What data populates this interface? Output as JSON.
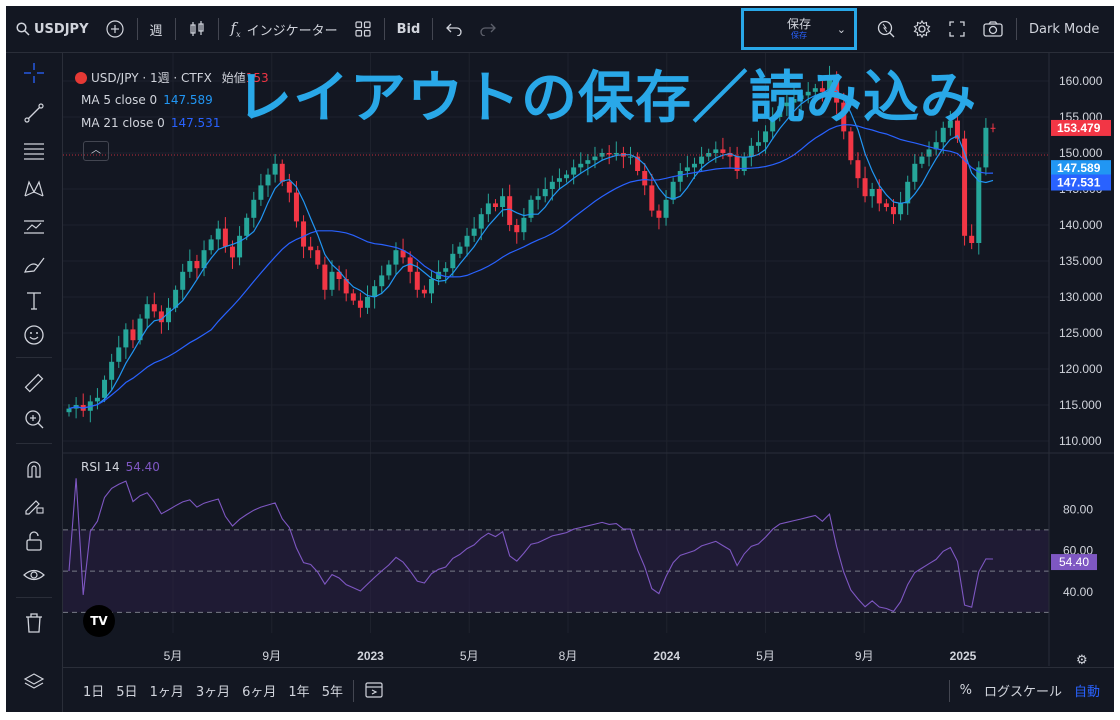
{
  "overlay_title": "レイアウトの保存／読み込み",
  "topbar": {
    "symbol": "USDJPY",
    "interval": "週",
    "indicators": "インジケーター",
    "bid": "Bid",
    "save_label": "保存",
    "save_sublabel": "保存",
    "dark_mode": "Dark Mode"
  },
  "legend": {
    "main": "USD/JPY · 1週 · CTFX",
    "open_label": "始値",
    "open_value": "153",
    "ma5_label": "MA 5 close 0",
    "ma5_value": "147.589",
    "ma21_label": "MA 21 close 0",
    "ma21_value": "147.531",
    "rsi_label": "RSI 14",
    "rsi_value": "54.40"
  },
  "price_axis": {
    "ticks": [
      "160.000",
      "155.000",
      "150.000",
      "145.000",
      "140.000",
      "135.000",
      "130.000",
      "125.000",
      "120.000",
      "115.000",
      "110.000"
    ],
    "labels": [
      {
        "text": "153.479",
        "color": "#f23645"
      },
      {
        "text": "147.589",
        "color": "#2196f3"
      },
      {
        "text": "147.531",
        "color": "#2962ff"
      }
    ]
  },
  "rsi_axis": {
    "ticks": [
      "80.00",
      "60.00",
      "40.00"
    ],
    "current": "54.40"
  },
  "time_axis": [
    "5月",
    "9月",
    "2023",
    "5月",
    "8月",
    "2024",
    "5月",
    "9月",
    "2025"
  ],
  "bottombar": {
    "ranges": [
      "1日",
      "5日",
      "1ヶ月",
      "3ヶ月",
      "6ヶ月",
      "1年",
      "5年"
    ],
    "percent": "%",
    "log": "ログスケール",
    "auto": "自動"
  },
  "colors": {
    "up": "#26a69a",
    "down": "#f23645",
    "ma5": "#2196f3",
    "ma21": "#2962ff",
    "rsi": "#7e57c2",
    "accent": "#29a8e8"
  },
  "chart_data": {
    "type": "candlestick",
    "price_range": [
      110,
      160
    ],
    "rsi_range": [
      20,
      100
    ],
    "rsi_band": [
      30,
      70
    ],
    "closes": [
      114.5,
      115.0,
      114.2,
      115.5,
      116.0,
      118.5,
      121.0,
      123.0,
      125.5,
      124.0,
      127.0,
      129.0,
      128.0,
      126.5,
      128.5,
      131.0,
      133.5,
      135.0,
      134.0,
      136.5,
      138.0,
      139.5,
      137.0,
      135.5,
      138.5,
      141.0,
      143.5,
      145.5,
      147.0,
      148.5,
      146.0,
      144.5,
      140.5,
      137.0,
      136.5,
      134.5,
      131.0,
      133.5,
      132.5,
      130.5,
      129.5,
      128.5,
      130.0,
      131.5,
      133.0,
      134.5,
      136.5,
      135.5,
      133.5,
      131.0,
      130.5,
      132.5,
      133.5,
      134.0,
      136.0,
      137.0,
      138.5,
      139.5,
      141.5,
      143.0,
      142.5,
      144.0,
      140.0,
      139.0,
      141.0,
      143.5,
      144.0,
      145.0,
      146.0,
      146.5,
      147.0,
      148.0,
      148.5,
      149.0,
      149.5,
      150.0,
      149.8,
      150.0,
      149.5,
      149.5,
      147.5,
      145.5,
      142.0,
      141.0,
      143.5,
      146.0,
      147.5,
      148.0,
      148.5,
      149.5,
      150.0,
      150.5,
      150.0,
      149.5,
      147.5,
      149.5,
      151.0,
      151.5,
      153.0,
      155.0,
      156.5,
      157.0,
      157.5,
      158.0,
      158.5,
      159.0,
      158.5,
      160.5,
      157.0,
      153.0,
      149.0,
      146.5,
      144.0,
      145.0,
      143.0,
      142.5,
      141.5,
      143.0,
      146.0,
      148.5,
      149.5,
      150.5,
      151.5,
      153.5,
      154.5,
      152.0,
      138.5,
      137.5,
      148.0,
      153.5,
      153.479
    ],
    "ma5_end": 147.589,
    "ma21_end": 147.531,
    "rsi_end": 54.4
  }
}
